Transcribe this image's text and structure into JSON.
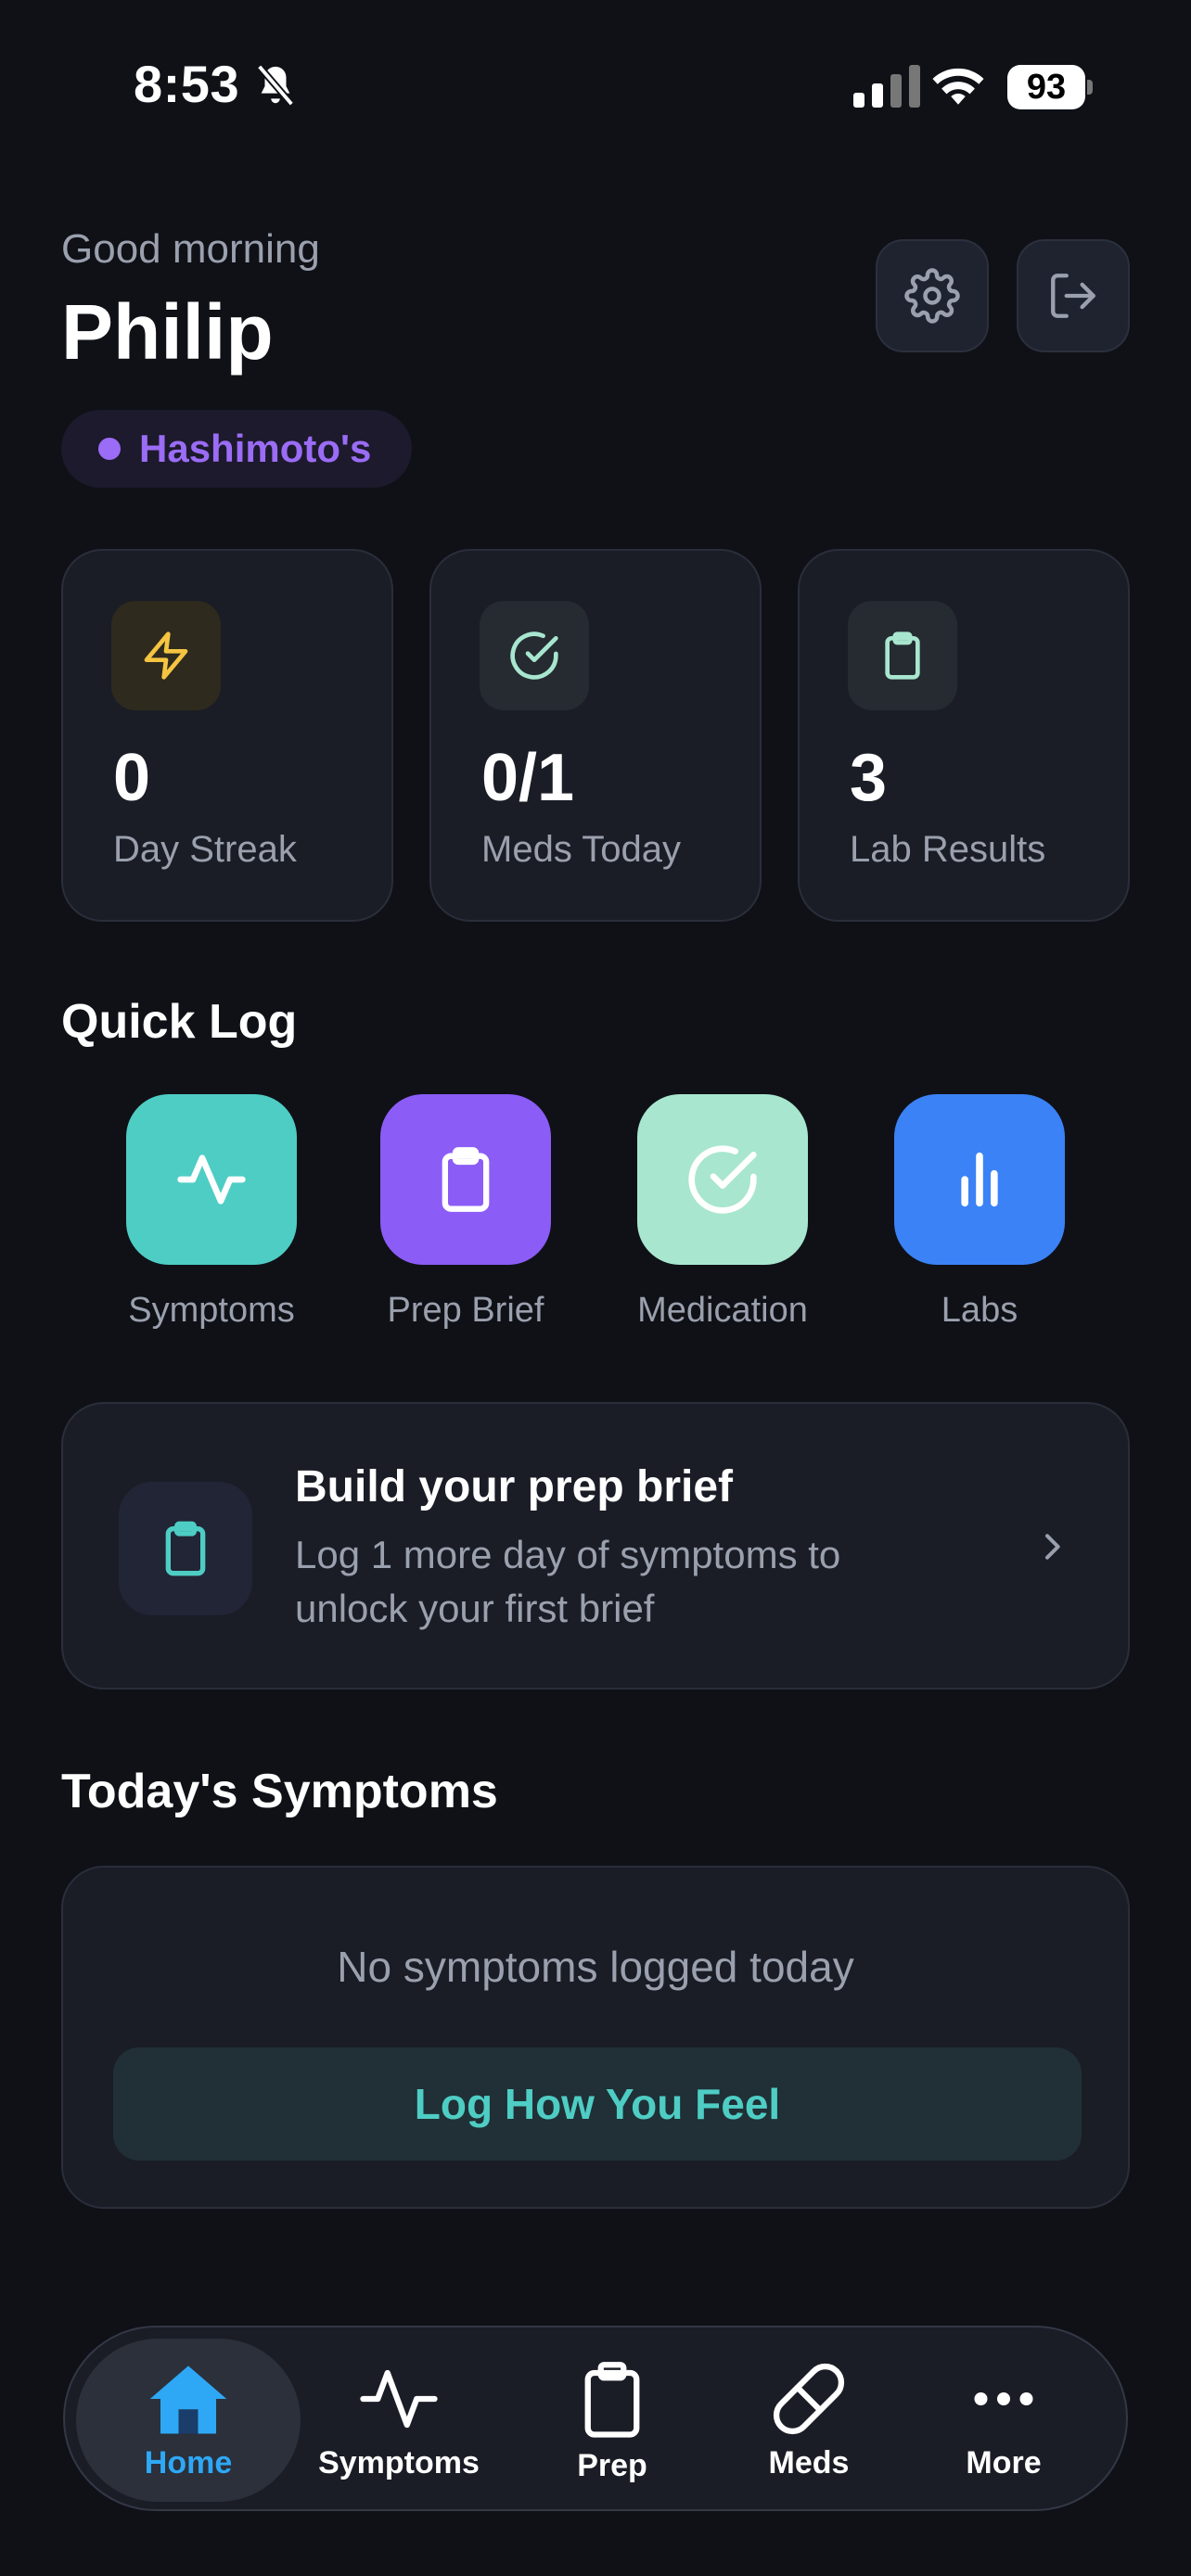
{
  "status_bar": {
    "time": "8:53",
    "battery": "93"
  },
  "header": {
    "greeting": "Good morning",
    "name": "Philip",
    "condition": "Hashimoto's"
  },
  "stats": [
    {
      "value": "0",
      "label": "Day Streak",
      "icon": "lightning-icon"
    },
    {
      "value": "0/1",
      "label": "Meds Today",
      "icon": "check-circle-icon"
    },
    {
      "value": "3",
      "label": "Lab Results",
      "icon": "clipboard-icon"
    }
  ],
  "quick_log": {
    "title": "Quick Log",
    "items": [
      {
        "label": "Symptoms",
        "color": "#4ecdc4",
        "icon": "pulse-icon"
      },
      {
        "label": "Prep Brief",
        "color": "#8b5cf6",
        "icon": "clipboard-icon"
      },
      {
        "label": "Medication",
        "color": "#a8e6cf",
        "icon": "check-circle-icon"
      },
      {
        "label": "Labs",
        "color": "#3b82f6",
        "icon": "bar-chart-icon"
      }
    ]
  },
  "prep_banner": {
    "title": "Build your prep brief",
    "subtitle": "Log 1 more day of symptoms to unlock your first brief"
  },
  "symptoms": {
    "title": "Today's Symptoms",
    "empty_text": "No symptoms logged today",
    "button_label": "Log How You Feel"
  },
  "tab_bar": {
    "items": [
      {
        "label": "Home",
        "icon": "home-icon",
        "active": true
      },
      {
        "label": "Symptoms",
        "icon": "pulse-icon"
      },
      {
        "label": "Prep",
        "icon": "clipboard-icon"
      },
      {
        "label": "Meds",
        "icon": "pill-icon"
      },
      {
        "label": "More",
        "icon": "more-icon"
      }
    ]
  },
  "colors": {
    "background": "#0f1117",
    "card": "#1a1d26",
    "accent_teal": "#4ecdc4",
    "accent_purple": "#9b6cf5",
    "active_tab": "#2ea8f5",
    "streak_yellow": "#f5c542"
  }
}
